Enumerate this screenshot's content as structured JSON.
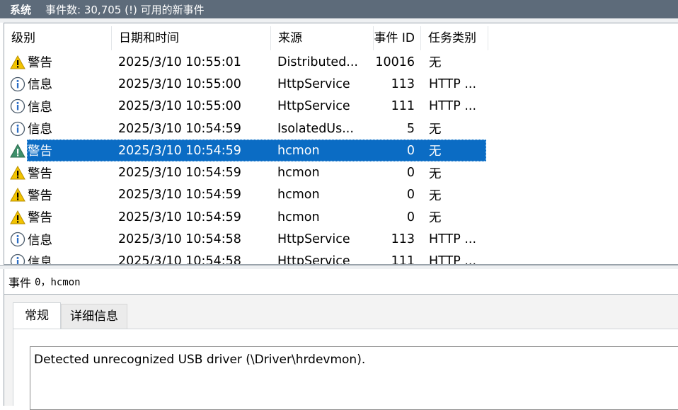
{
  "title_bar": {
    "log_name": "系统",
    "event_count_text": "事件数: 30,705 (!) 可用的新事件"
  },
  "event_list": {
    "columns": [
      "级别",
      "日期和时间",
      "来源",
      "事件 ID",
      "任务类别"
    ],
    "rows": [
      {
        "level": "警告",
        "level_type": "warning",
        "datetime": "2025/3/10 10:55:01",
        "source": "Distributed...",
        "event_id": "10016",
        "task": "无",
        "selected": false
      },
      {
        "level": "信息",
        "level_type": "info",
        "datetime": "2025/3/10 10:55:00",
        "source": "HttpService",
        "event_id": "113",
        "task": "HTTP ...",
        "selected": false
      },
      {
        "level": "信息",
        "level_type": "info",
        "datetime": "2025/3/10 10:55:00",
        "source": "HttpService",
        "event_id": "111",
        "task": "HTTP ...",
        "selected": false
      },
      {
        "level": "信息",
        "level_type": "info",
        "datetime": "2025/3/10 10:54:59",
        "source": "IsolatedUs...",
        "event_id": "5",
        "task": "无",
        "selected": false
      },
      {
        "level": "警告",
        "level_type": "warning",
        "datetime": "2025/3/10 10:54:59",
        "source": "hcmon",
        "event_id": "0",
        "task": "无",
        "selected": true
      },
      {
        "level": "警告",
        "level_type": "warning",
        "datetime": "2025/3/10 10:54:59",
        "source": "hcmon",
        "event_id": "0",
        "task": "无",
        "selected": false
      },
      {
        "level": "警告",
        "level_type": "warning",
        "datetime": "2025/3/10 10:54:59",
        "source": "hcmon",
        "event_id": "0",
        "task": "无",
        "selected": false
      },
      {
        "level": "警告",
        "level_type": "warning",
        "datetime": "2025/3/10 10:54:59",
        "source": "hcmon",
        "event_id": "0",
        "task": "无",
        "selected": false
      },
      {
        "level": "信息",
        "level_type": "info",
        "datetime": "2025/3/10 10:54:58",
        "source": "HttpService",
        "event_id": "113",
        "task": "HTTP ...",
        "selected": false
      },
      {
        "level": "信息",
        "level_type": "info",
        "datetime": "2025/3/10 10:54:58",
        "source": "HttpService",
        "event_id": "111",
        "task": "HTTP ...",
        "selected": false
      }
    ]
  },
  "detail": {
    "header_prefix": "事件",
    "header_event": "0，hcmon",
    "tabs": [
      {
        "label": "常规",
        "active": true
      },
      {
        "label": "详细信息",
        "active": false
      }
    ],
    "description": "Detected unrecognized USB driver (\\Driver\\hrdevmon)."
  },
  "colors": {
    "title_bar_bg": "#5d6b7a",
    "selection_bg": "#0b6cc4",
    "warning_icon": "#f2c300",
    "info_icon": "#2b6cc4"
  },
  "icons": {
    "warning": "warning-triangle-icon",
    "info": "info-circle-icon"
  }
}
